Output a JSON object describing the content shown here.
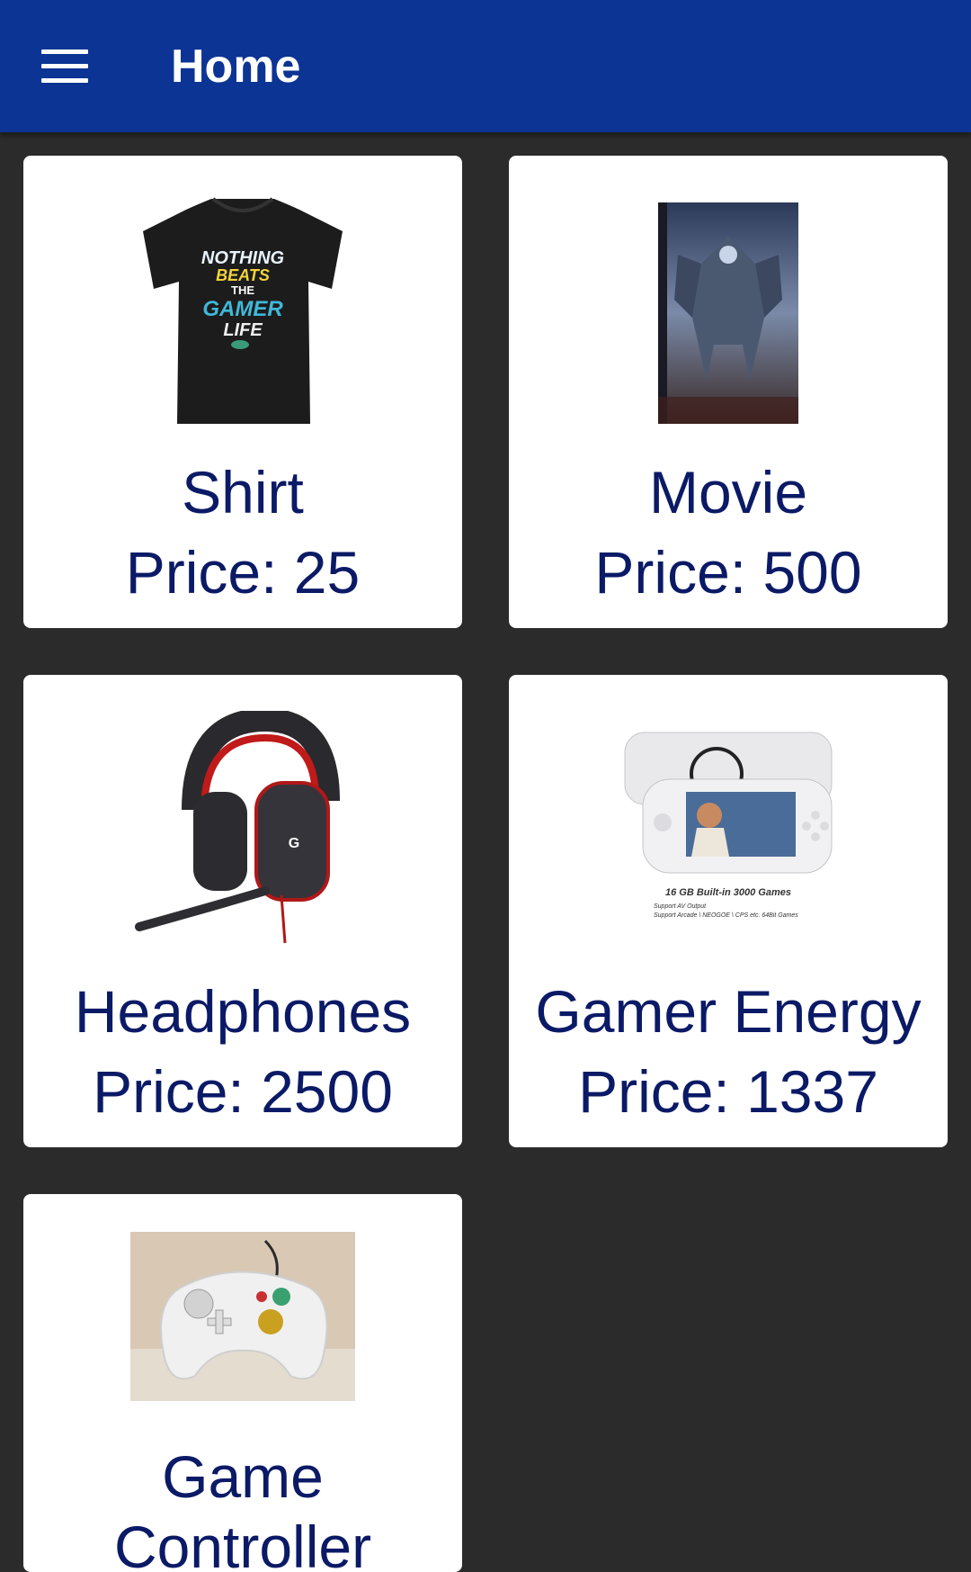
{
  "appbar": {
    "title": "Home",
    "menu_icon": "hamburger-menu-icon"
  },
  "products": [
    {
      "name": "Shirt",
      "price": "Price: 25",
      "image": "shirt-image"
    },
    {
      "name": "Movie",
      "price": "Price: 500",
      "image": "movie-image"
    },
    {
      "name": "Headphones",
      "price": "Price: 2500",
      "image": "headphones-image"
    },
    {
      "name": "Gamer Energy",
      "price": "Price: 1337",
      "image": "handheld-console-image",
      "image_text": [
        "16 GB Built-in 3000 Games",
        "Support AV Output",
        "Support Arcade \\ NEOGOE \\ CPS etc. 64Bit Games"
      ]
    },
    {
      "name_line1": "Game",
      "name_line2": "Controller",
      "image": "controller-image"
    }
  ],
  "shirt_text": [
    "NOTHING",
    "BEATS",
    "THE",
    "GAMER",
    "LIFE"
  ],
  "colors": {
    "appbar": "#0c3494",
    "background": "#2b2b2b",
    "card": "#ffffff",
    "text": "#0b1a66"
  }
}
